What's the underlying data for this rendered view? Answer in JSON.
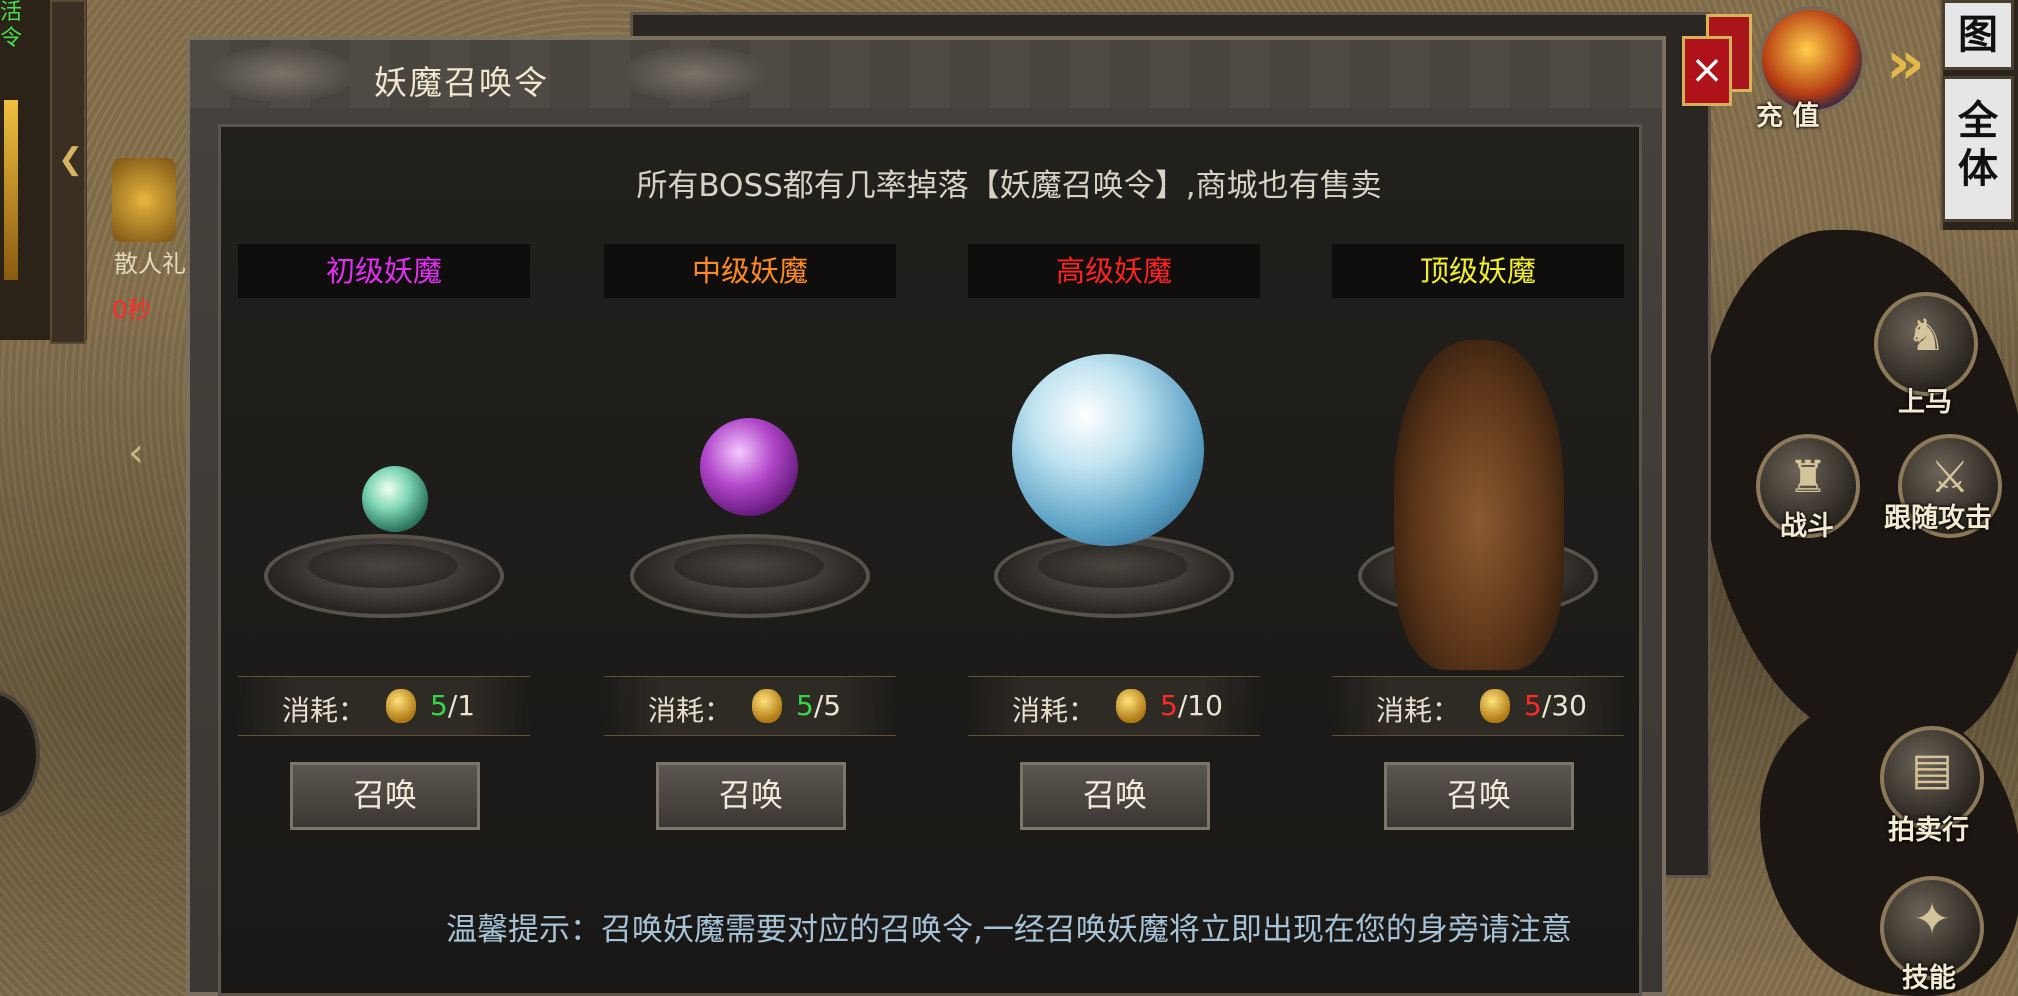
{
  "hud": {
    "top_left_text": "活\n令",
    "scatter_label": "散人礼",
    "timer": "0秒",
    "recharge_label": "充 值",
    "right_btn_map": "图",
    "right_btn_all": "全\n体",
    "mount_label": "上马",
    "battle_label": "战斗",
    "follow_attack_label": "跟随攻击",
    "auction_label": "拍卖行",
    "skills_label": "技能"
  },
  "dialog": {
    "title": "妖魔召唤令",
    "close_label": "×",
    "description": "所有BOSS都有几率掉落【妖魔召唤令】,商城也有售卖",
    "tip": "温馨提示：召唤妖魔需要对应的召唤令,一经召唤妖魔将立即出现在您的身旁请注意",
    "cost_label": "消耗：",
    "summon_label": "召唤",
    "cards": [
      {
        "name": "初级妖魔",
        "name_color": "#e22ef0",
        "owned": "5",
        "owned_color": "#35d64a",
        "required": "/1"
      },
      {
        "name": "中级妖魔",
        "name_color": "#ff8a1f",
        "owned": "5",
        "owned_color": "#35d64a",
        "required": "/5"
      },
      {
        "name": "高级妖魔",
        "name_color": "#ff2222",
        "owned": "5",
        "owned_color": "#ff2a2a",
        "required": "/10"
      },
      {
        "name": "顶级妖魔",
        "name_color": "#f2f02a",
        "owned": "5",
        "owned_color": "#ff2a2a",
        "required": "/30"
      }
    ]
  }
}
